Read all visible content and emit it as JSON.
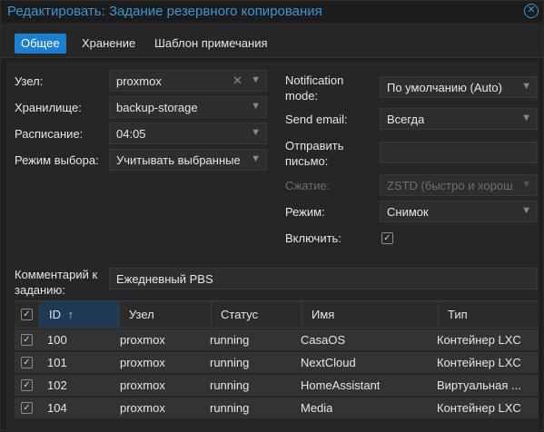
{
  "dialog": {
    "title": "Редактировать: Задание резервного копирования"
  },
  "tabs": [
    {
      "label": "Общее"
    },
    {
      "label": "Хранение"
    },
    {
      "label": "Шаблон примечания"
    }
  ],
  "form": {
    "node_label": "Узел:",
    "node_value": "proxmox",
    "storage_label": "Хранилище:",
    "storage_value": "backup-storage",
    "schedule_label": "Расписание:",
    "schedule_value": "04:05",
    "selection_mode_label": "Режим выбора:",
    "selection_mode_value": "Учитывать выбранные",
    "notification_mode_label": "Notification mode:",
    "notification_mode_value": "По умолчанию (Auto)",
    "send_email_label": "Send email:",
    "send_email_value": "Всегда",
    "send_to_label": "Отправить письмо:",
    "send_to_value": "",
    "compression_label": "Сжатие:",
    "compression_value": "ZSTD (быстро и хорош",
    "mode_label": "Режим:",
    "mode_value": "Снимок",
    "enable_label": "Включить:",
    "enable_checked": true,
    "comment_label": "Комментарий к заданию:",
    "comment_value": "Ежедневный PBS"
  },
  "table": {
    "columns": [
      "ID",
      "Узел",
      "Статус",
      "Имя",
      "Тип"
    ],
    "sort_indicator": "↑",
    "rows": [
      {
        "id": "100",
        "node": "proxmox",
        "status": "running",
        "name": "CasaOS",
        "type": "Контейнер LXC",
        "checked": true
      },
      {
        "id": "101",
        "node": "proxmox",
        "status": "running",
        "name": "NextCloud",
        "type": "Контейнер LXC",
        "checked": true
      },
      {
        "id": "102",
        "node": "proxmox",
        "status": "running",
        "name": "HomeAssistant",
        "type": "Виртуальная ...",
        "checked": true
      },
      {
        "id": "104",
        "node": "proxmox",
        "status": "running",
        "name": "Media",
        "type": "Контейнер LXC",
        "checked": true
      }
    ]
  },
  "icons": {
    "close": "close-icon",
    "dropdown": "chevron-down-icon",
    "clear": "clear-x-icon",
    "check": "check-icon",
    "sort": "sort-asc-icon"
  },
  "colors": {
    "accent": "#3b95d6",
    "active_tab": "#1d7fd0",
    "background": "#1f1f1f"
  }
}
